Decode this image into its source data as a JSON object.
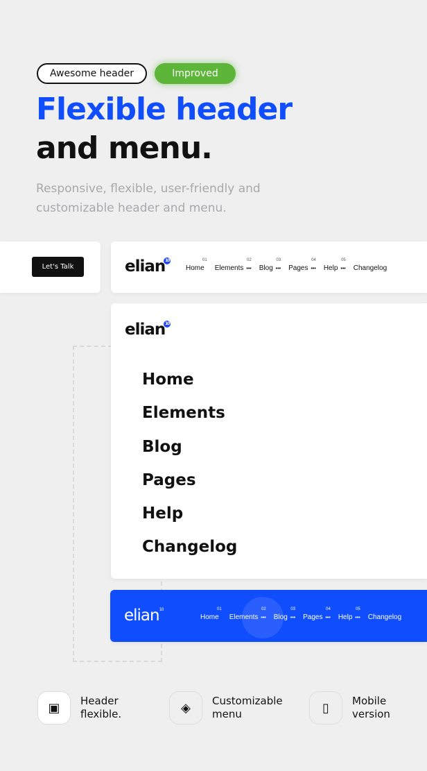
{
  "badges": {
    "awesome": "Awesome header",
    "improved": "Improved"
  },
  "title": {
    "line1": "Flexible header",
    "line2": "and menu."
  },
  "subtitle": "Responsive, flexible, user-friendly and customizable header and menu.",
  "cta": "Let's Talk",
  "logo": {
    "text": "elian",
    "badge": "10"
  },
  "nav": [
    {
      "label": "Home",
      "num": "01",
      "dots": ""
    },
    {
      "label": "Elements",
      "num": "02",
      "dots": "•••"
    },
    {
      "label": "Blog",
      "num": "03",
      "dots": "•••"
    },
    {
      "label": "Pages",
      "num": "04",
      "dots": "•••"
    },
    {
      "label": "Help",
      "num": "05",
      "dots": "•••"
    },
    {
      "label": "Changelog",
      "num": "",
      "dots": ""
    }
  ],
  "mobile_menu": [
    "Home",
    "Elements",
    "Blog",
    "Pages",
    "Help",
    "Changelog"
  ],
  "features": [
    {
      "label": "Header flexible.",
      "icon": "window-icon"
    },
    {
      "label": "Customizable menu",
      "icon": "layers-icon"
    },
    {
      "label": "Mobile version",
      "icon": "tablet-icon"
    }
  ],
  "colors": {
    "accent": "#0f4dfd",
    "green": "#5db53a"
  }
}
